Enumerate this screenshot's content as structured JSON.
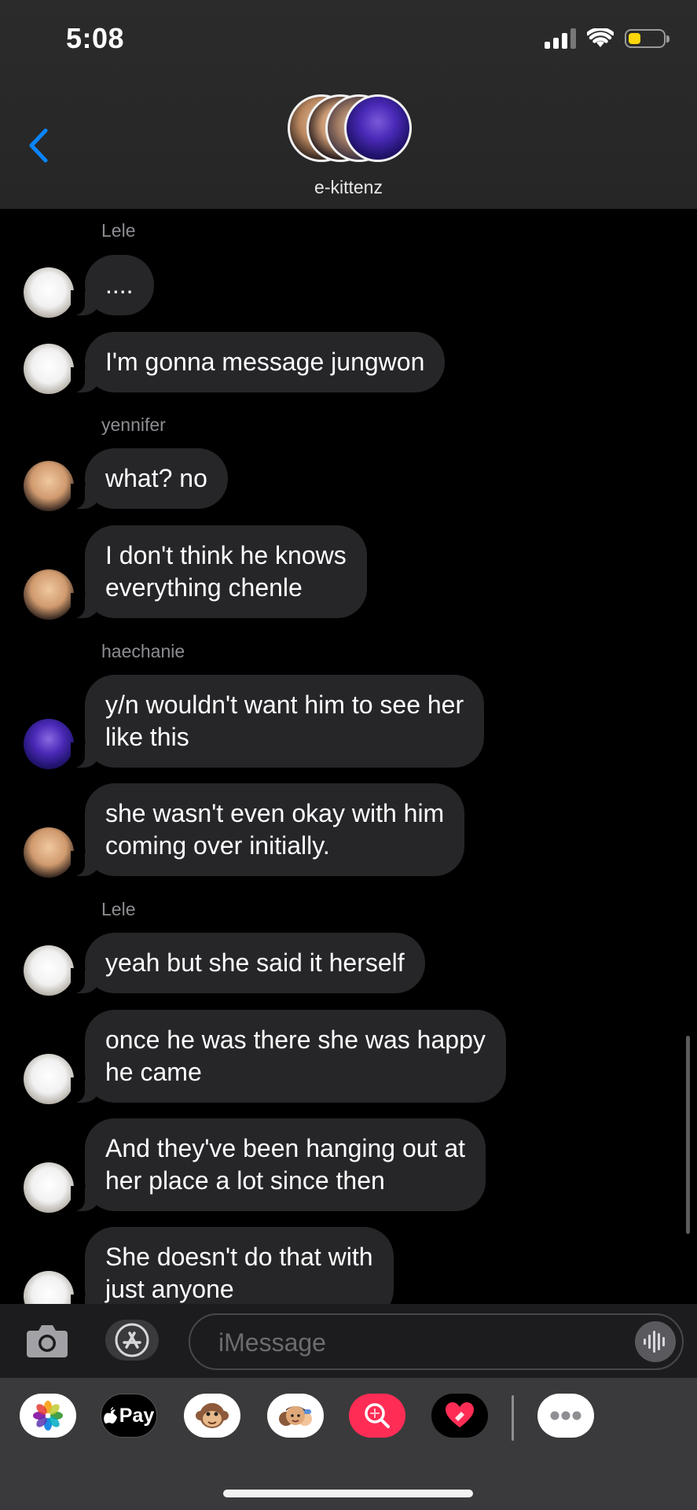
{
  "status_bar": {
    "time": "5:08",
    "battery_level": 0.35,
    "battery_color": "#ffd60a"
  },
  "header": {
    "group_name": "e-kittenz"
  },
  "messages": [
    {
      "sender": "Lele"
    },
    {
      "text": "...."
    },
    {
      "text": "I'm gonna message jungwon"
    },
    {
      "sender": "yennifer"
    },
    {
      "text": "what? no"
    },
    {
      "text": "I don't think he knows\neverything chenle"
    },
    {
      "sender": "haechanie"
    },
    {
      "text": "y/n wouldn't want him to see her\nlike this"
    },
    {
      "text": "she wasn't even okay with him\ncoming over initially."
    },
    {
      "sender": "Lele"
    },
    {
      "text": "yeah but she said it herself"
    },
    {
      "text": "once he was there she was happy\nhe came"
    },
    {
      "text": "And they've been hanging out at\nher place a lot since then"
    },
    {
      "text": "She doesn't do that with\njust anyone"
    }
  ],
  "input": {
    "placeholder": "iMessage"
  },
  "app_strip": {
    "apps": [
      "photos-icon",
      "apple-pay-icon",
      "animoji-icon",
      "memoji-icon",
      "image-search-icon",
      "digital-touch-icon",
      "more-apps-icon"
    ],
    "apple_pay_label": "Pay"
  },
  "colors": {
    "bubble": "#262629",
    "accent": "#0a84ff",
    "background": "#000000"
  }
}
